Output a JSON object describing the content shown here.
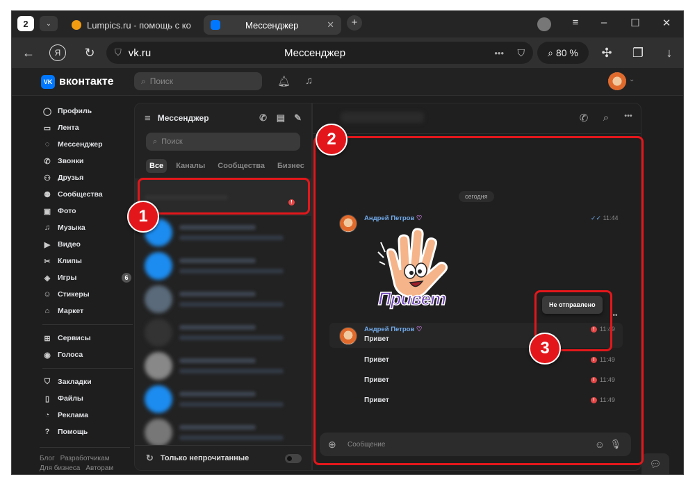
{
  "browser": {
    "tab_count": "2",
    "tabs": [
      {
        "title": "Lumpics.ru - помощь с ком"
      },
      {
        "title": "Мессенджер"
      }
    ],
    "address": "vk.ru",
    "page_title": "Мессенджер",
    "zoom": "80 %"
  },
  "vk": {
    "brand": "вконтакте",
    "logo_text": "VK",
    "search_placeholder": "Поиск"
  },
  "sidebar": {
    "items": [
      {
        "label": "Профиль",
        "icon": "profile-icon"
      },
      {
        "label": "Лента",
        "icon": "feed-icon"
      },
      {
        "label": "Мессенджер",
        "icon": "messenger-icon"
      },
      {
        "label": "Звонки",
        "icon": "phone-icon"
      },
      {
        "label": "Друзья",
        "icon": "friends-icon"
      },
      {
        "label": "Сообщества",
        "icon": "communities-icon"
      },
      {
        "label": "Фото",
        "icon": "photo-icon"
      },
      {
        "label": "Музыка",
        "icon": "music-icon"
      },
      {
        "label": "Видео",
        "icon": "video-icon"
      },
      {
        "label": "Клипы",
        "icon": "clips-icon"
      },
      {
        "label": "Игры",
        "icon": "games-icon",
        "badge": "6"
      },
      {
        "label": "Стикеры",
        "icon": "stickers-icon"
      },
      {
        "label": "Маркет",
        "icon": "market-icon"
      }
    ],
    "items2": [
      {
        "label": "Сервисы",
        "icon": "services-icon"
      },
      {
        "label": "Голоса",
        "icon": "votes-icon"
      }
    ],
    "items3": [
      {
        "label": "Закладки",
        "icon": "bookmarks-icon"
      },
      {
        "label": "Файлы",
        "icon": "files-icon"
      },
      {
        "label": "Реклама",
        "icon": "ads-icon"
      },
      {
        "label": "Помощь",
        "icon": "help-icon"
      }
    ],
    "footer": [
      "Блог",
      "Разработчикам",
      "Для бизнеса",
      "Авторам"
    ]
  },
  "messenger": {
    "title": "Мессенджер",
    "search_placeholder": "Поиск",
    "tabs": [
      "Все",
      "Каналы",
      "Сообщества",
      "Бизнес"
    ],
    "only_unread": "Только непрочитанные"
  },
  "chat": {
    "date": "сегодня",
    "sticker_text": "Привет",
    "messages": [
      {
        "author": "Андрей Петров",
        "text": "",
        "time": "11:44"
      },
      {
        "author": "Андрей Петров",
        "text": "Привет",
        "time": "11:49"
      },
      {
        "author": "",
        "text": "Привет",
        "time": "11:49"
      },
      {
        "author": "",
        "text": "Привет",
        "time": "11:49"
      },
      {
        "author": "",
        "text": "Привет",
        "time": "11:49"
      }
    ],
    "tooltip": "Не отправлено",
    "composer_placeholder": "Сообщение"
  },
  "annotations": [
    "1",
    "2",
    "3"
  ],
  "colors": {
    "accent": "#0077ff",
    "annotation": "#e3171b",
    "link": "#71aaeb",
    "error": "#e64646"
  }
}
